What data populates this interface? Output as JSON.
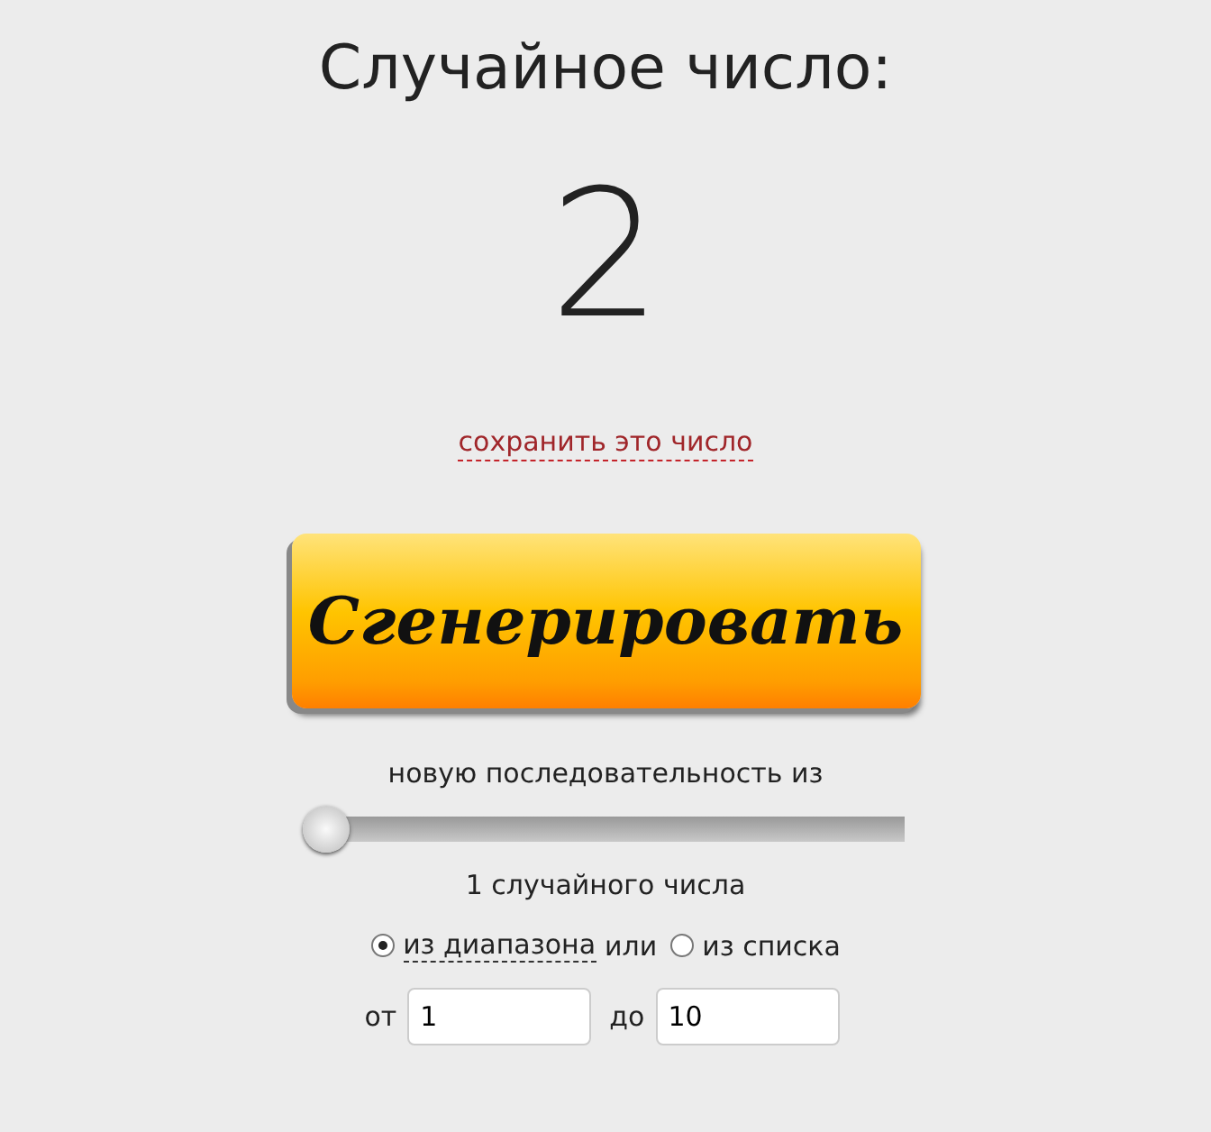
{
  "title": "Случайное число:",
  "result": "2",
  "save_link": "сохранить это число",
  "generate_button": "Сгенерировать",
  "sequence_label": "новую последовательность из",
  "count_slider": {
    "level": 0
  },
  "count_label": "1 случайного числа",
  "source": [
    {
      "label": "из диапазона",
      "selected": true
    },
    {
      "label": "из списка",
      "selected": false
    }
  ],
  "source_separator": "или",
  "range": [
    {
      "label": "от",
      "value": "1"
    },
    {
      "label": "до",
      "value": "10"
    }
  ]
}
